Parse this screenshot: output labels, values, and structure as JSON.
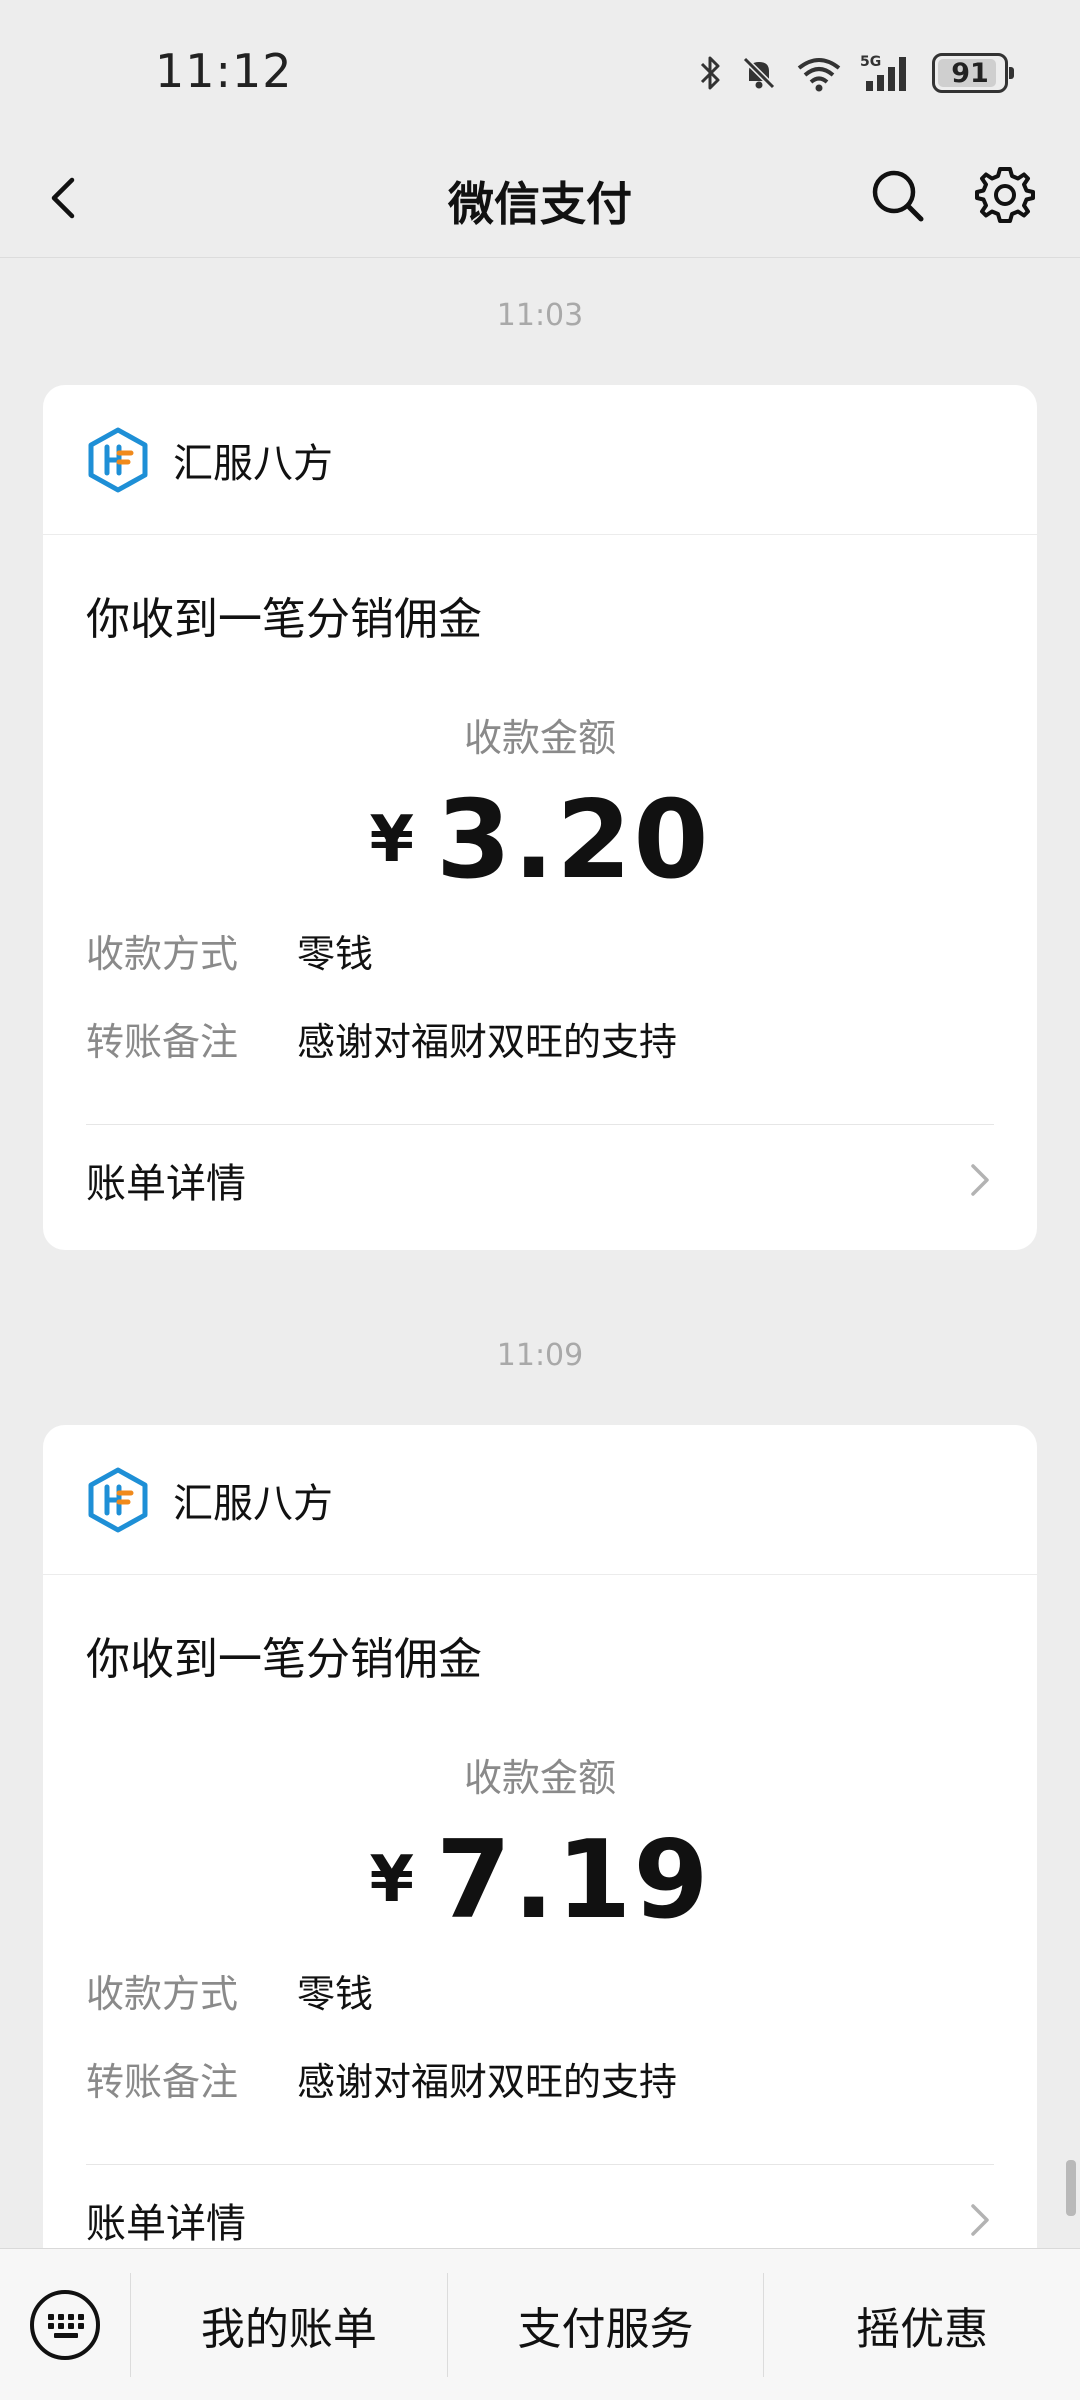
{
  "status_bar": {
    "time": "11:12",
    "battery": "91",
    "battery_level": 0.91,
    "network": "5G"
  },
  "nav": {
    "title": "微信支付"
  },
  "messages": [
    {
      "time": "11:03",
      "merchant": "汇服八方",
      "title": "你收到一笔分销佣金",
      "amount_label": "收款金额",
      "currency": "¥",
      "amount": "3.20",
      "method_label": "收款方式",
      "method_value": "零钱",
      "note_label": "转账备注",
      "note_value": "感谢对福财双旺的支持",
      "footer_label": "账单详情"
    },
    {
      "time": "11:09",
      "merchant": "汇服八方",
      "title": "你收到一笔分销佣金",
      "amount_label": "收款金额",
      "currency": "¥",
      "amount": "7.19",
      "method_label": "收款方式",
      "method_value": "零钱",
      "note_label": "转账备注",
      "note_value": "感谢对福财双旺的支持",
      "footer_label": "账单详情"
    }
  ],
  "bottom_menu": {
    "items": [
      "我的账单",
      "支付服务",
      "摇优惠"
    ]
  },
  "colors": {
    "background": "#ededed",
    "card": "#ffffff",
    "logo_blue": "#1e8fd6",
    "logo_orange": "#f08a1c"
  },
  "icons": {
    "back": "back-arrow-icon",
    "search": "search-icon",
    "settings": "gear-icon",
    "keyboard": "keyboard-icon",
    "chevron": "chevron-right-icon"
  }
}
